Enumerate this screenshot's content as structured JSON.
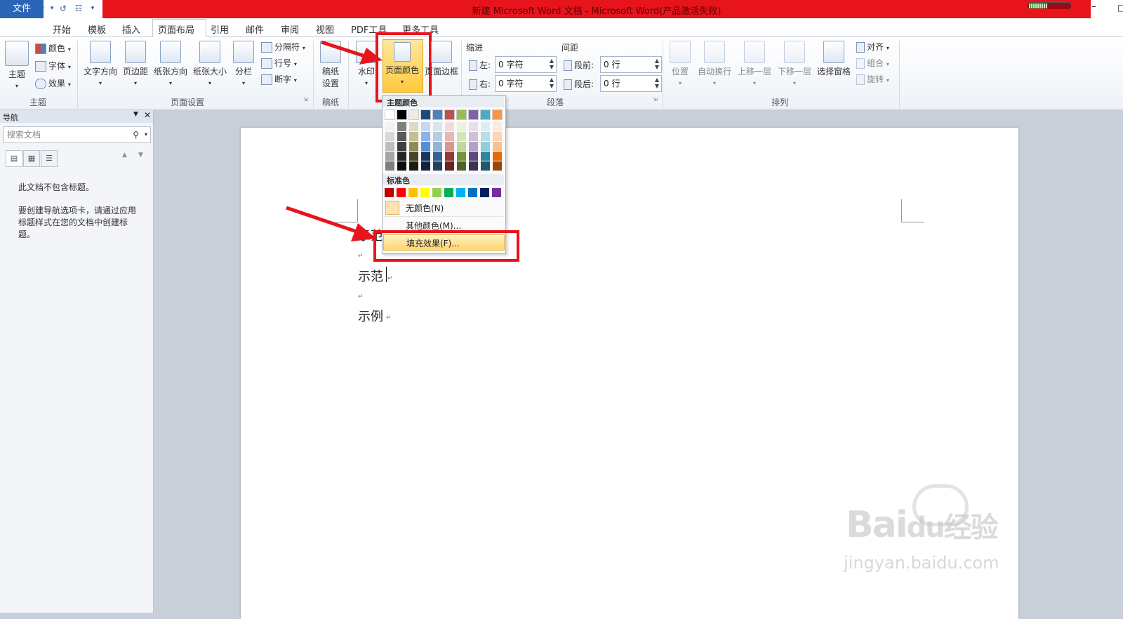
{
  "app": {
    "title": "新建 Microsoft Word 文档 - Microsoft Word(产品激活失败)",
    "logo": "W"
  },
  "tabs": [
    {
      "label": "文件"
    },
    {
      "label": "开始"
    },
    {
      "label": "模板"
    },
    {
      "label": "插入"
    },
    {
      "label": "页面布局"
    },
    {
      "label": "引用"
    },
    {
      "label": "邮件"
    },
    {
      "label": "审阅"
    },
    {
      "label": "视图"
    },
    {
      "label": "PDF工具"
    },
    {
      "label": "更多工具"
    }
  ],
  "ribbon": {
    "theme": {
      "main": "主题",
      "colors": "颜色",
      "fonts": "字体",
      "effects": "效果",
      "group": "主题"
    },
    "page_setup": {
      "text_dir": "文字方向",
      "margins": "页边距",
      "orientation": "纸张方向",
      "size": "纸张大小",
      "columns": "分栏",
      "breaks": "分隔符",
      "line_numbers": "行号",
      "hyphenation": "断字",
      "group": "页面设置"
    },
    "draft": {
      "line1": "稿纸",
      "line2": "设置",
      "group": "稿纸"
    },
    "background": {
      "watermark": "水印",
      "page_color": "页面颜色",
      "page_border": "页面边框"
    },
    "paragraph": {
      "indent": "缩进",
      "spacing": "间距",
      "left_label": "左:",
      "left_value": "0 字符",
      "right_label": "右:",
      "right_value": "0 字符",
      "before_label": "段前:",
      "before_value": "0 行",
      "after_label": "段后:",
      "after_value": "0 行",
      "group": "段落"
    },
    "arrange": {
      "position": "位置",
      "wrap": "自动换行",
      "forward": "上移一层",
      "backward": "下移一层",
      "selection_pane": "选择窗格",
      "align": "对齐",
      "group_btn": "组合",
      "rotate": "旋转",
      "group": "排列"
    }
  },
  "nav": {
    "title": "导航",
    "search_placeholder": "搜索文档",
    "no_headings": "此文档不包含标题。",
    "help": "要创建导航选项卡，请通过应用标题样式在您的文档中创建标题。"
  },
  "document": {
    "lines": [
      "示范",
      "示例"
    ],
    "first_line_partial": "示范"
  },
  "dropdown": {
    "theme_header": "主题颜色",
    "standard_header": "标准色",
    "no_color": "无颜色(N)",
    "more_colors": "其他颜色(M)...",
    "fill_effects": "填充效果(F)...",
    "theme_top": [
      "#ffffff",
      "#000000",
      "#eeece1",
      "#1f497d",
      "#4f81bd",
      "#c0504d",
      "#9bbb59",
      "#8064a2",
      "#4bacc6",
      "#f79646"
    ],
    "theme_shades": [
      [
        "#f2f2f2",
        "#d8d8d8",
        "#bfbfbf",
        "#a5a5a5",
        "#7f7f7f"
      ],
      [
        "#7f7f7f",
        "#595959",
        "#3f3f3f",
        "#262626",
        "#0c0c0c"
      ],
      [
        "#ddd9c3",
        "#c4bd97",
        "#938953",
        "#494429",
        "#1d1b10"
      ],
      [
        "#c6d9f0",
        "#8db3e2",
        "#548dd4",
        "#17365d",
        "#0f243e"
      ],
      [
        "#dbe5f1",
        "#b8cce4",
        "#95b3d7",
        "#366092",
        "#244061"
      ],
      [
        "#f2dcdb",
        "#e5b9b7",
        "#d99694",
        "#953734",
        "#632423"
      ],
      [
        "#ebf1dd",
        "#d7e3bc",
        "#c3d69b",
        "#76923c",
        "#4f6128"
      ],
      [
        "#e5e0ec",
        "#ccc1d9",
        "#b2a2c7",
        "#5f497a",
        "#3f3151"
      ],
      [
        "#dbeef3",
        "#b7dde8",
        "#92cddc",
        "#31859b",
        "#205867"
      ],
      [
        "#fdeada",
        "#fbd5b5",
        "#fac08f",
        "#e36c09",
        "#974806"
      ]
    ],
    "standard": [
      "#c00000",
      "#ff0000",
      "#ffc000",
      "#ffff00",
      "#92d050",
      "#00b050",
      "#00b0f0",
      "#0070c0",
      "#002060",
      "#7030a0"
    ]
  },
  "watermark": {
    "text1": "Bai",
    "text2": "du",
    "text3": "经验",
    "url": "jingyan.baidu.com"
  },
  "colors": {
    "accent": "#e8141c",
    "file_tab": "#2a66b5"
  }
}
